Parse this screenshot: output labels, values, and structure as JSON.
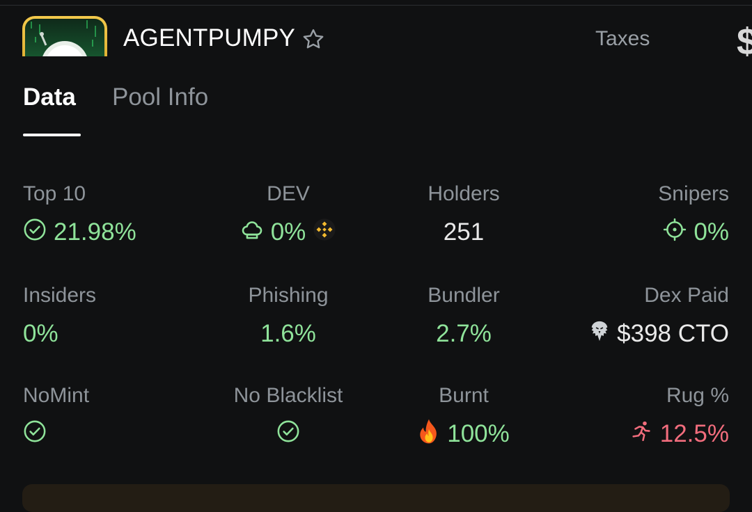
{
  "header": {
    "token_name": "AGENTPUMPY",
    "taxes_label": "Taxes",
    "currency_partial": "$"
  },
  "tabs": [
    {
      "label": "Data",
      "active": true
    },
    {
      "label": "Pool Info",
      "active": false
    }
  ],
  "stats": {
    "top10": {
      "label": "Top 10",
      "value": "21.98%",
      "icon": "check-circle-icon"
    },
    "dev": {
      "label": "DEV",
      "value": "0%",
      "icon": "chef-hat-icon",
      "badge": "binance-icon"
    },
    "holders": {
      "label": "Holders",
      "value": "251"
    },
    "snipers": {
      "label": "Snipers",
      "value": "0%",
      "icon": "crosshair-icon"
    },
    "insiders": {
      "label": "Insiders",
      "value": "0%"
    },
    "phishing": {
      "label": "Phishing",
      "value": "1.6%"
    },
    "bundler": {
      "label": "Bundler",
      "value": "2.7%"
    },
    "dex_paid": {
      "label": "Dex Paid",
      "value": "$398 CTO",
      "icon": "eagle-icon"
    },
    "nomint": {
      "label": "NoMint",
      "icon": "check-circle-icon"
    },
    "no_blacklist": {
      "label": "No Blacklist",
      "icon": "check-circle-icon"
    },
    "burnt": {
      "label": "Burnt",
      "value": "100%",
      "icon": "fire-icon"
    },
    "rug": {
      "label": "Rug %",
      "value": "12.5%",
      "icon": "running-person-icon"
    }
  },
  "colors": {
    "background": "#101112",
    "positive": "#8fe39a",
    "negative": "#f26d7d",
    "label": "#8e949a"
  }
}
